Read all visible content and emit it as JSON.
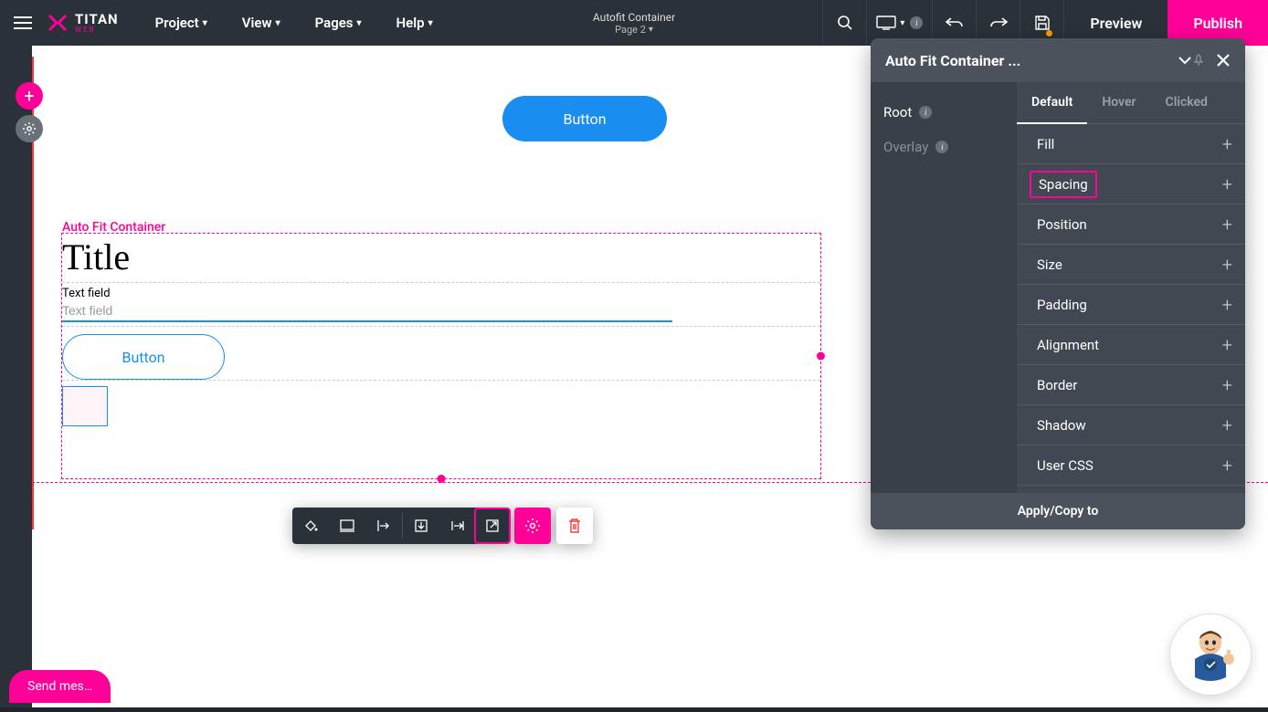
{
  "header": {
    "brand": {
      "name": "TITAN",
      "sub": "WEB"
    },
    "menu": [
      "Project",
      "View",
      "Pages",
      "Help"
    ],
    "center": {
      "title": "Autofit Container",
      "page": "Page 2"
    },
    "preview": "Preview",
    "publish": "Publish"
  },
  "canvas": {
    "blue_button": "Button",
    "afc_label": "Auto Fit Container",
    "title": "Title",
    "field_label": "Text field",
    "field_placeholder": "Text field",
    "outline_button": "Button"
  },
  "props": {
    "title": "Auto Fit Container ...",
    "left_items": [
      {
        "label": "Root",
        "dim": false
      },
      {
        "label": "Overlay",
        "dim": true
      }
    ],
    "tabs": [
      "Default",
      "Hover",
      "Clicked"
    ],
    "active_tab": 0,
    "sections": [
      "Fill",
      "Spacing",
      "Position",
      "Size",
      "Padding",
      "Alignment",
      "Border",
      "Shadow",
      "User CSS"
    ],
    "highlight_section": "Spacing",
    "footer": "Apply/Copy to"
  },
  "chat": {
    "label": "Send mes…"
  }
}
